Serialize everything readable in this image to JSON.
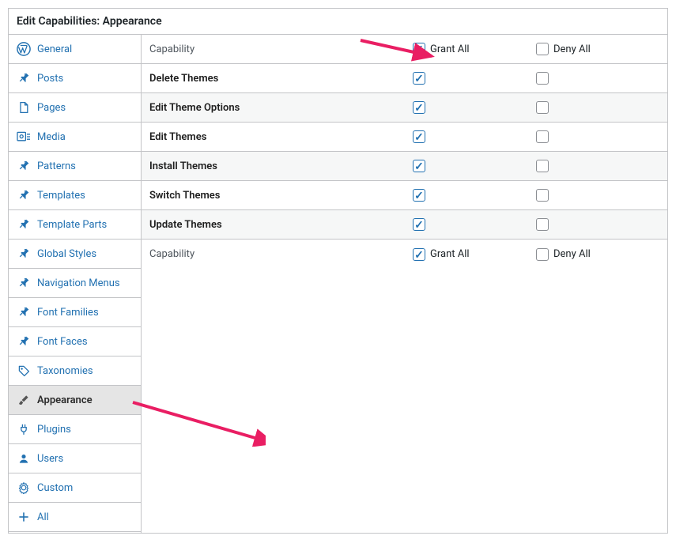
{
  "title": "Edit Capabilities: Appearance",
  "sidebar": {
    "items": [
      {
        "label": "General",
        "icon": "wordpress"
      },
      {
        "label": "Posts",
        "icon": "pin"
      },
      {
        "label": "Pages",
        "icon": "page"
      },
      {
        "label": "Media",
        "icon": "media"
      },
      {
        "label": "Patterns",
        "icon": "pin"
      },
      {
        "label": "Templates",
        "icon": "pin"
      },
      {
        "label": "Template Parts",
        "icon": "pin"
      },
      {
        "label": "Global Styles",
        "icon": "pin"
      },
      {
        "label": "Navigation Menus",
        "icon": "pin"
      },
      {
        "label": "Font Families",
        "icon": "pin"
      },
      {
        "label": "Font Faces",
        "icon": "pin"
      },
      {
        "label": "Taxonomies",
        "icon": "tag"
      },
      {
        "label": "Appearance",
        "icon": "brush",
        "active": true
      },
      {
        "label": "Plugins",
        "icon": "plug"
      },
      {
        "label": "Users",
        "icon": "user"
      },
      {
        "label": "Custom",
        "icon": "gear"
      },
      {
        "label": "All",
        "icon": "plus"
      }
    ]
  },
  "headers": {
    "capability": "Capability",
    "grant_all": "Grant All",
    "deny_all": "Deny All"
  },
  "capabilities": [
    {
      "label": "Delete Themes",
      "grant": true,
      "deny": false
    },
    {
      "label": "Edit Theme Options",
      "grant": true,
      "deny": false
    },
    {
      "label": "Edit Themes",
      "grant": true,
      "deny": false
    },
    {
      "label": "Install Themes",
      "grant": true,
      "deny": false
    },
    {
      "label": "Switch Themes",
      "grant": true,
      "deny": false
    },
    {
      "label": "Update Themes",
      "grant": true,
      "deny": false
    }
  ],
  "grant_all_checked": true,
  "deny_all_checked": false
}
